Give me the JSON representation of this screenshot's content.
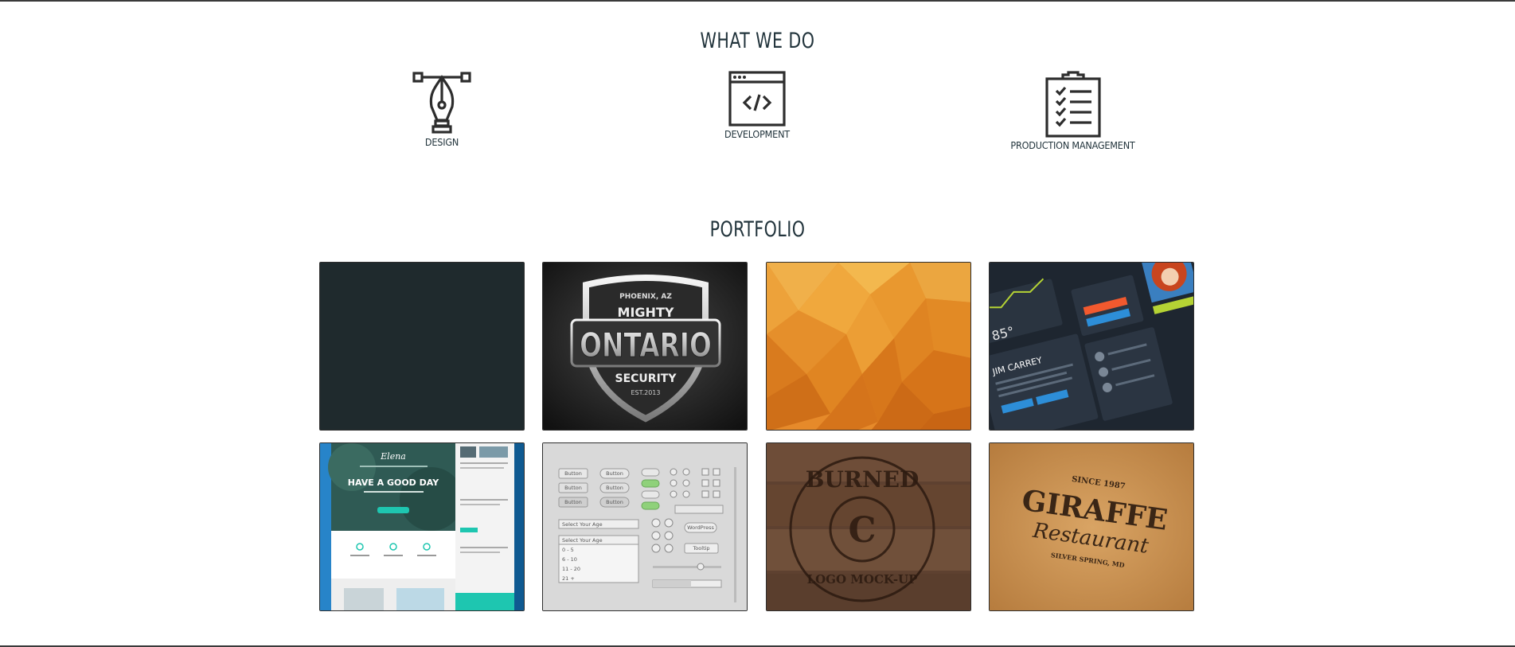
{
  "whatwedo": {
    "title": "WHAT WE DO",
    "services": [
      {
        "label": "DESIGN",
        "icon": "pen-nib-icon"
      },
      {
        "label": "DEVELOPMENT",
        "icon": "code-window-icon"
      },
      {
        "label": "PRODUCTION MANAGEMENT",
        "icon": "clipboard-checklist-icon"
      }
    ]
  },
  "portfolio": {
    "title": "PORTFOLIO",
    "tiles": [
      {
        "name": "dark-slate-tile"
      },
      {
        "name": "mighty-ontario-security-logo",
        "logo_text": [
          "PHOENIX, AZ",
          "MIGHTY",
          "ONTARIO",
          "SECURITY",
          "EST.2013"
        ]
      },
      {
        "name": "orange-lowpoly-tile"
      },
      {
        "name": "dark-ui-kit-tile",
        "texts": [
          "85°",
          "JIM CARREY"
        ]
      },
      {
        "name": "elena-website-tile",
        "texts": [
          "Elena",
          "HAVE A GOOD DAY"
        ]
      },
      {
        "name": "ui-controls-tile",
        "texts": [
          "Button",
          "Button",
          "Button",
          "Button",
          "Button",
          "Button",
          "Select Your Age",
          "Select Your Age",
          "0 - 5",
          "6 - 10",
          "11 - 20",
          "21 +",
          "WordPress",
          "Tooltip"
        ]
      },
      {
        "name": "burned-logo-mockup-tile",
        "logo_text": [
          "BURNED",
          "C",
          "LOGO MOCK-UP"
        ]
      },
      {
        "name": "giraffe-restaurant-tile",
        "logo_text": [
          "SINCE 1987",
          "GIRAFFE",
          "Restaurant",
          "SILVER SPRING, MD"
        ]
      }
    ]
  },
  "colors": {
    "heading": "#22343c",
    "border": "#2e2e2e",
    "dark_tile": "#1f2a2d"
  }
}
